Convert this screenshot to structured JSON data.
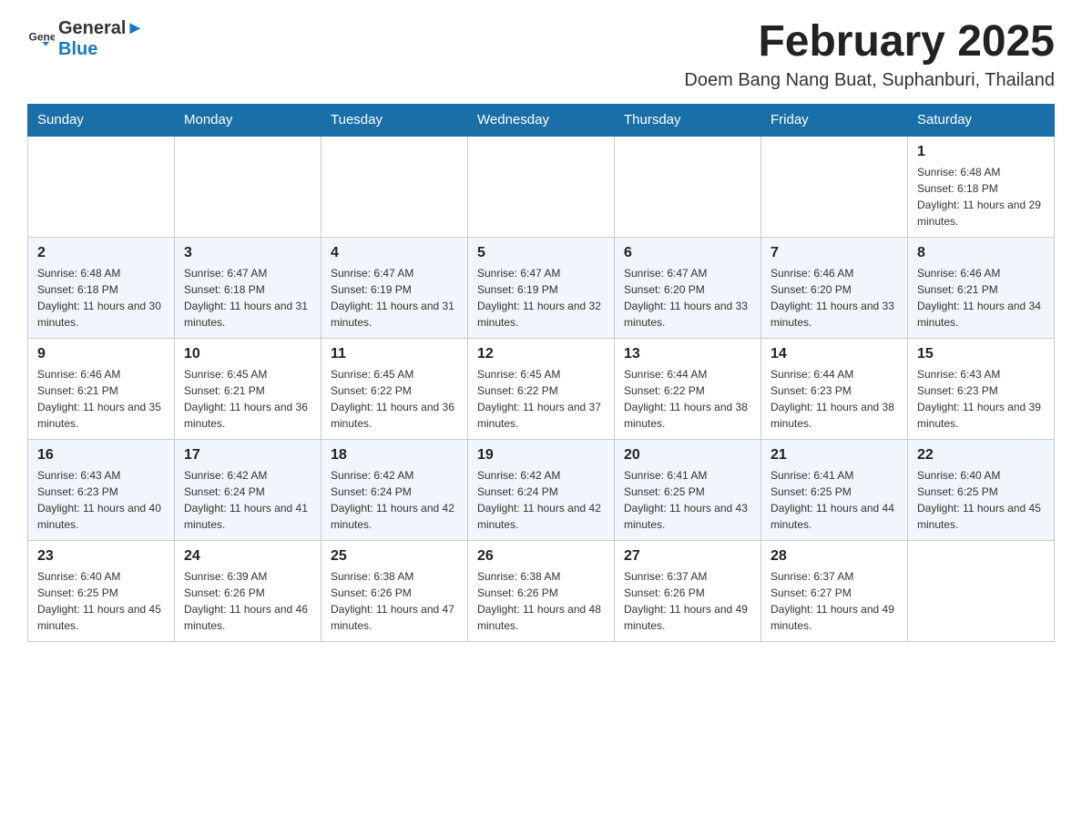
{
  "logo": {
    "text_black": "General",
    "text_blue": "Blue"
  },
  "header": {
    "title": "February 2025",
    "subtitle": "Doem Bang Nang Buat, Suphanburi, Thailand"
  },
  "weekdays": [
    "Sunday",
    "Monday",
    "Tuesday",
    "Wednesday",
    "Thursday",
    "Friday",
    "Saturday"
  ],
  "weeks": [
    [
      {
        "day": "",
        "info": ""
      },
      {
        "day": "",
        "info": ""
      },
      {
        "day": "",
        "info": ""
      },
      {
        "day": "",
        "info": ""
      },
      {
        "day": "",
        "info": ""
      },
      {
        "day": "",
        "info": ""
      },
      {
        "day": "1",
        "info": "Sunrise: 6:48 AM\nSunset: 6:18 PM\nDaylight: 11 hours and 29 minutes."
      }
    ],
    [
      {
        "day": "2",
        "info": "Sunrise: 6:48 AM\nSunset: 6:18 PM\nDaylight: 11 hours and 30 minutes."
      },
      {
        "day": "3",
        "info": "Sunrise: 6:47 AM\nSunset: 6:18 PM\nDaylight: 11 hours and 31 minutes."
      },
      {
        "day": "4",
        "info": "Sunrise: 6:47 AM\nSunset: 6:19 PM\nDaylight: 11 hours and 31 minutes."
      },
      {
        "day": "5",
        "info": "Sunrise: 6:47 AM\nSunset: 6:19 PM\nDaylight: 11 hours and 32 minutes."
      },
      {
        "day": "6",
        "info": "Sunrise: 6:47 AM\nSunset: 6:20 PM\nDaylight: 11 hours and 33 minutes."
      },
      {
        "day": "7",
        "info": "Sunrise: 6:46 AM\nSunset: 6:20 PM\nDaylight: 11 hours and 33 minutes."
      },
      {
        "day": "8",
        "info": "Sunrise: 6:46 AM\nSunset: 6:21 PM\nDaylight: 11 hours and 34 minutes."
      }
    ],
    [
      {
        "day": "9",
        "info": "Sunrise: 6:46 AM\nSunset: 6:21 PM\nDaylight: 11 hours and 35 minutes."
      },
      {
        "day": "10",
        "info": "Sunrise: 6:45 AM\nSunset: 6:21 PM\nDaylight: 11 hours and 36 minutes."
      },
      {
        "day": "11",
        "info": "Sunrise: 6:45 AM\nSunset: 6:22 PM\nDaylight: 11 hours and 36 minutes."
      },
      {
        "day": "12",
        "info": "Sunrise: 6:45 AM\nSunset: 6:22 PM\nDaylight: 11 hours and 37 minutes."
      },
      {
        "day": "13",
        "info": "Sunrise: 6:44 AM\nSunset: 6:22 PM\nDaylight: 11 hours and 38 minutes."
      },
      {
        "day": "14",
        "info": "Sunrise: 6:44 AM\nSunset: 6:23 PM\nDaylight: 11 hours and 38 minutes."
      },
      {
        "day": "15",
        "info": "Sunrise: 6:43 AM\nSunset: 6:23 PM\nDaylight: 11 hours and 39 minutes."
      }
    ],
    [
      {
        "day": "16",
        "info": "Sunrise: 6:43 AM\nSunset: 6:23 PM\nDaylight: 11 hours and 40 minutes."
      },
      {
        "day": "17",
        "info": "Sunrise: 6:42 AM\nSunset: 6:24 PM\nDaylight: 11 hours and 41 minutes."
      },
      {
        "day": "18",
        "info": "Sunrise: 6:42 AM\nSunset: 6:24 PM\nDaylight: 11 hours and 42 minutes."
      },
      {
        "day": "19",
        "info": "Sunrise: 6:42 AM\nSunset: 6:24 PM\nDaylight: 11 hours and 42 minutes."
      },
      {
        "day": "20",
        "info": "Sunrise: 6:41 AM\nSunset: 6:25 PM\nDaylight: 11 hours and 43 minutes."
      },
      {
        "day": "21",
        "info": "Sunrise: 6:41 AM\nSunset: 6:25 PM\nDaylight: 11 hours and 44 minutes."
      },
      {
        "day": "22",
        "info": "Sunrise: 6:40 AM\nSunset: 6:25 PM\nDaylight: 11 hours and 45 minutes."
      }
    ],
    [
      {
        "day": "23",
        "info": "Sunrise: 6:40 AM\nSunset: 6:25 PM\nDaylight: 11 hours and 45 minutes."
      },
      {
        "day": "24",
        "info": "Sunrise: 6:39 AM\nSunset: 6:26 PM\nDaylight: 11 hours and 46 minutes."
      },
      {
        "day": "25",
        "info": "Sunrise: 6:38 AM\nSunset: 6:26 PM\nDaylight: 11 hours and 47 minutes."
      },
      {
        "day": "26",
        "info": "Sunrise: 6:38 AM\nSunset: 6:26 PM\nDaylight: 11 hours and 48 minutes."
      },
      {
        "day": "27",
        "info": "Sunrise: 6:37 AM\nSunset: 6:26 PM\nDaylight: 11 hours and 49 minutes."
      },
      {
        "day": "28",
        "info": "Sunrise: 6:37 AM\nSunset: 6:27 PM\nDaylight: 11 hours and 49 minutes."
      },
      {
        "day": "",
        "info": ""
      }
    ]
  ]
}
